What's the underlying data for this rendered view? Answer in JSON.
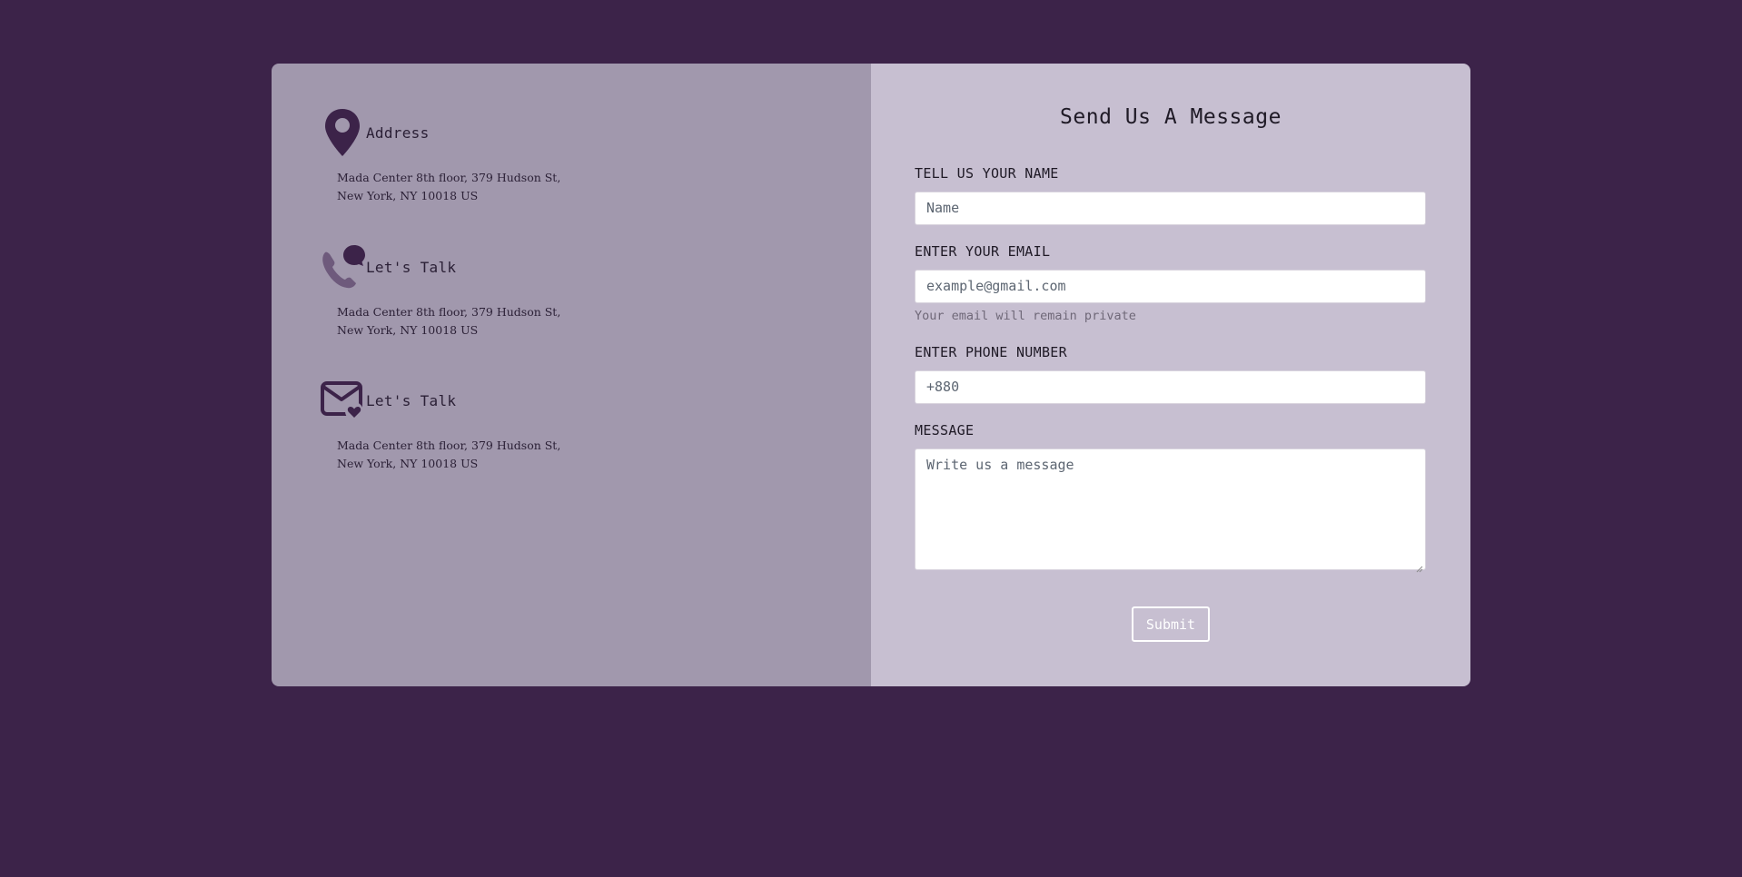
{
  "contact_info": {
    "items": [
      {
        "icon": "map-pin-icon",
        "title": "Address",
        "line1": "Mada Center 8th floor, 379 Hudson St,",
        "line2": "New York, NY 10018 US"
      },
      {
        "icon": "phone-chat-icon",
        "title": "Let's Talk",
        "line1": "Mada Center 8th floor, 379 Hudson St,",
        "line2": "New York, NY 10018 US"
      },
      {
        "icon": "mail-heart-icon",
        "title": "Let's Talk",
        "line1": "Mada Center 8th floor, 379 Hudson St,",
        "line2": "New York, NY 10018 US"
      }
    ]
  },
  "form": {
    "title": "Send Us A Message",
    "name_label": "TELL US YOUR NAME",
    "name_placeholder": "Name",
    "email_label": "ENTER YOUR EMAIL",
    "email_placeholder": "example@gmail.com",
    "email_hint": "Your email will remain private",
    "phone_label": "ENTER PHONE NUMBER",
    "phone_placeholder": "+880",
    "message_label": "MESSAGE",
    "message_placeholder": "Write us a message",
    "submit_label": "Submit"
  },
  "colors": {
    "page_background": "#3c2349",
    "left_panel": "#a198ad",
    "right_panel": "#c7bfd1",
    "icon_dark": "#3c2349",
    "icon_muted": "#6e5a7c"
  }
}
